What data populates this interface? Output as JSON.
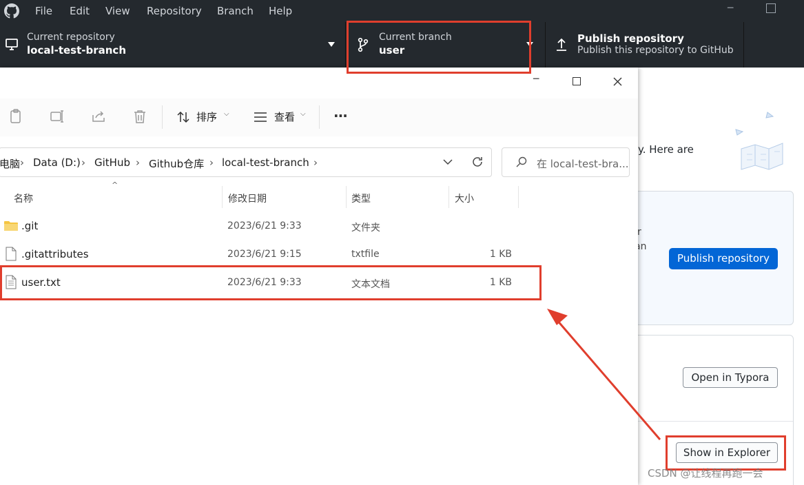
{
  "menubar": {
    "items": [
      "File",
      "Edit",
      "View",
      "Repository",
      "Branch",
      "Help"
    ]
  },
  "toolbar": {
    "repo_label": "Current repository",
    "repo_value": "local-test-branch",
    "branch_label": "Current branch",
    "branch_value": "user",
    "publish_title": "Publish repository",
    "publish_sub": "Publish this repository to GitHub"
  },
  "gh_panel": {
    "intro_fragment": "y. Here are",
    "card_fragment_1": "r",
    "card_fragment_2": "an",
    "publish_button": "Publish repository",
    "typora_button": "Open in Typora",
    "explorer_button": "Show in Explorer"
  },
  "explorer": {
    "cmd": {
      "sort_label": "排序",
      "view_label": "查看",
      "more_label": "···"
    },
    "breadcrumb": [
      "电脑",
      "Data (D:)",
      "GitHub",
      "Github仓库",
      "local-test-branch"
    ],
    "search_placeholder": "在 local-test-bra...",
    "columns": [
      "名称",
      "修改日期",
      "类型",
      "大小"
    ],
    "files": [
      {
        "name": ".git",
        "date": "2023/6/21 9:33",
        "type": "文件夹",
        "size": ""
      },
      {
        "name": ".gitattributes",
        "date": "2023/6/21 9:15",
        "type": "txtfile",
        "size": "1 KB"
      },
      {
        "name": "user.txt",
        "date": "2023/6/21 9:33",
        "type": "文本文档",
        "size": "1 KB"
      }
    ]
  },
  "watermark": "CSDN @让线程再跑一会",
  "colors": {
    "gh_dark": "#24292e",
    "gh_blue": "#0366d6",
    "annotation_red": "#e03e2d",
    "folder_yellow": "#f5c542"
  }
}
